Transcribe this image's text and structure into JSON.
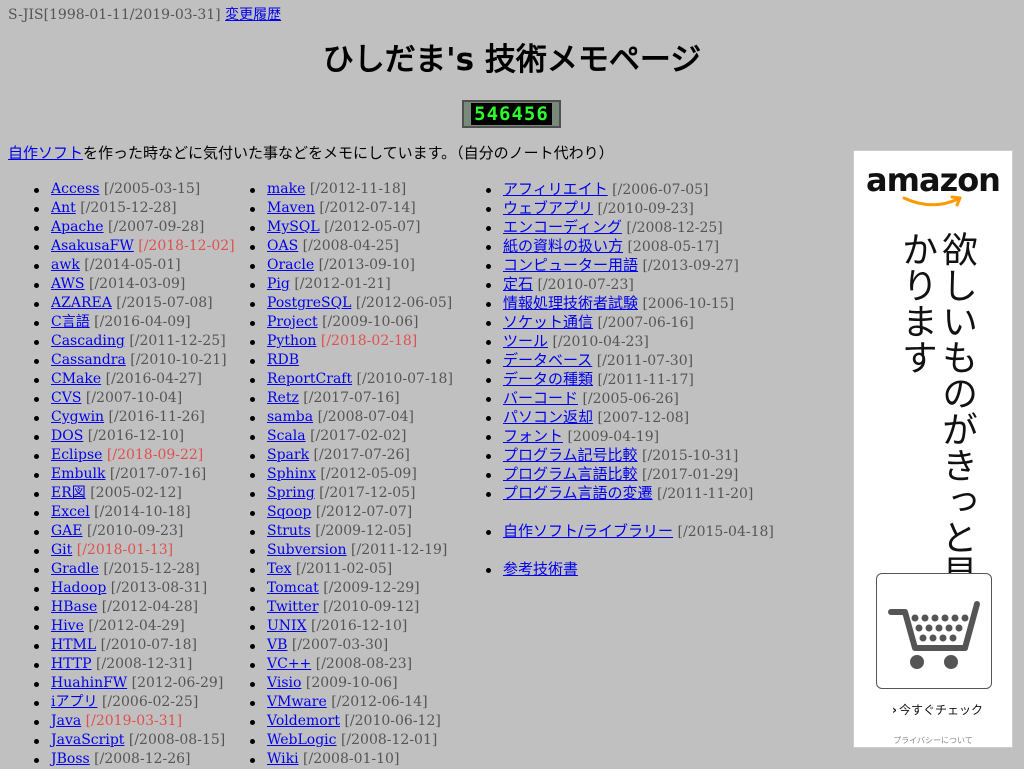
{
  "topline": {
    "prefix": "S-JIS[1998-01-11/2019-03-31]",
    "link": "変更履歴"
  },
  "title": "ひしだま's 技術メモページ",
  "counter": "546456",
  "intro": {
    "link": "自作ソフト",
    "text": "を作った時などに気付いた事などをメモにしています。（自分のノート代わり）"
  },
  "col1": [
    {
      "label": "Access",
      "date": "[/2005-03-15]",
      "red": false
    },
    {
      "label": "Ant",
      "date": "[/2015-12-28]",
      "red": false
    },
    {
      "label": "Apache",
      "date": "[/2007-09-28]",
      "red": false
    },
    {
      "label": "AsakusaFW",
      "date": "[/2018-12-02]",
      "red": true
    },
    {
      "label": "awk",
      "date": "[/2014-05-01]",
      "red": false
    },
    {
      "label": "AWS",
      "date": "[/2014-03-09]",
      "red": false
    },
    {
      "label": "AZAREA",
      "date": "[/2015-07-08]",
      "red": false
    },
    {
      "label": "C言語",
      "date": "[/2016-04-09]",
      "red": false
    },
    {
      "label": "Cascading",
      "date": "[/2011-12-25]",
      "red": false
    },
    {
      "label": "Cassandra",
      "date": "[/2010-10-21]",
      "red": false
    },
    {
      "label": "CMake",
      "date": "[/2016-04-27]",
      "red": false
    },
    {
      "label": "CVS",
      "date": "[/2007-10-04]",
      "red": false
    },
    {
      "label": "Cygwin",
      "date": "[/2016-11-26]",
      "red": false
    },
    {
      "label": "DOS",
      "date": "[/2016-12-10]",
      "red": false
    },
    {
      "label": "Eclipse",
      "date": "[/2018-09-22]",
      "red": true
    },
    {
      "label": "Embulk",
      "date": "[/2017-07-16]",
      "red": false
    },
    {
      "label": "ER図",
      "date": "[2005-02-12]",
      "red": false
    },
    {
      "label": "Excel",
      "date": "[/2014-10-18]",
      "red": false
    },
    {
      "label": "GAE",
      "date": "[/2010-09-23]",
      "red": false
    },
    {
      "label": "Git",
      "date": "[/2018-01-13]",
      "red": true
    },
    {
      "label": "Gradle",
      "date": "[/2015-12-28]",
      "red": false
    },
    {
      "label": "Hadoop",
      "date": "[/2013-08-31]",
      "red": false
    },
    {
      "label": "HBase",
      "date": "[/2012-04-28]",
      "red": false
    },
    {
      "label": "Hive",
      "date": "[/2012-04-29]",
      "red": false
    },
    {
      "label": "HTML",
      "date": "[/2010-07-18]",
      "red": false
    },
    {
      "label": "HTTP",
      "date": "[/2008-12-31]",
      "red": false
    },
    {
      "label": "HuahinFW",
      "date": "[2012-06-29]",
      "red": false
    },
    {
      "label": "iアプリ",
      "date": "[/2006-02-25]",
      "red": false
    },
    {
      "label": "Java",
      "date": "[/2019-03-31]",
      "red": true
    },
    {
      "label": "JavaScript",
      "date": "[/2008-08-15]",
      "red": false
    },
    {
      "label": "JBoss",
      "date": "[/2008-12-26]",
      "red": false
    }
  ],
  "col2": [
    {
      "label": "make",
      "date": "[/2012-11-18]",
      "red": false
    },
    {
      "label": "Maven",
      "date": "[/2012-07-14]",
      "red": false
    },
    {
      "label": "MySQL",
      "date": "[/2012-05-07]",
      "red": false
    },
    {
      "label": "OAS",
      "date": "[/2008-04-25]",
      "red": false
    },
    {
      "label": "Oracle",
      "date": "[/2013-09-10]",
      "red": false
    },
    {
      "label": "Pig",
      "date": "[/2012-01-21]",
      "red": false
    },
    {
      "label": "PostgreSQL",
      "date": "[/2012-06-05]",
      "red": false
    },
    {
      "label": "Project",
      "date": "[/2009-10-06]",
      "red": false
    },
    {
      "label": "Python",
      "date": "[/2018-02-18]",
      "red": true
    },
    {
      "label": "RDB",
      "date": "",
      "red": false
    },
    {
      "label": "ReportCraft",
      "date": "[/2010-07-18]",
      "red": false
    },
    {
      "label": "Retz",
      "date": "[/2017-07-16]",
      "red": false
    },
    {
      "label": "samba",
      "date": "[/2008-07-04]",
      "red": false
    },
    {
      "label": "Scala",
      "date": "[/2017-02-02]",
      "red": false
    },
    {
      "label": "Spark",
      "date": "[/2017-07-26]",
      "red": false
    },
    {
      "label": "Sphinx",
      "date": "[/2012-05-09]",
      "red": false
    },
    {
      "label": "Spring",
      "date": "[/2017-12-05]",
      "red": false
    },
    {
      "label": "Sqoop",
      "date": "[/2012-07-07]",
      "red": false
    },
    {
      "label": "Struts",
      "date": "[/2009-12-05]",
      "red": false
    },
    {
      "label": "Subversion",
      "date": "[/2011-12-19]",
      "red": false
    },
    {
      "label": "Tex",
      "date": "[/2011-02-05]",
      "red": false
    },
    {
      "label": "Tomcat",
      "date": "[/2009-12-29]",
      "red": false
    },
    {
      "label": "Twitter",
      "date": "[/2010-09-12]",
      "red": false
    },
    {
      "label": "UNIX",
      "date": "[/2016-12-10]",
      "red": false
    },
    {
      "label": "VB",
      "date": "[/2007-03-30]",
      "red": false
    },
    {
      "label": "VC++",
      "date": "[/2008-08-23]",
      "red": false
    },
    {
      "label": "Visio",
      "date": "[2009-10-06]",
      "red": false
    },
    {
      "label": "VMware",
      "date": "[/2012-06-14]",
      "red": false
    },
    {
      "label": "Voldemort",
      "date": "[/2010-06-12]",
      "red": false
    },
    {
      "label": "WebLogic",
      "date": "[/2008-12-01]",
      "red": false
    },
    {
      "label": "Wiki",
      "date": "[/2008-01-10]",
      "red": false
    }
  ],
  "col3": [
    {
      "label": "アフィリエイト",
      "date": "[/2006-07-05]",
      "gap_before": false
    },
    {
      "label": "ウェブアプリ",
      "date": "[/2010-09-23]",
      "gap_before": false
    },
    {
      "label": "エンコーディング",
      "date": "[/2008-12-25]",
      "gap_before": false
    },
    {
      "label": "紙の資料の扱い方",
      "date": "[2008-05-17]",
      "gap_before": false
    },
    {
      "label": "コンピューター用語",
      "date": "[/2013-09-27]",
      "gap_before": false
    },
    {
      "label": "定石",
      "date": "[/2010-07-23]",
      "gap_before": false
    },
    {
      "label": "情報処理技術者試験",
      "date": "[2006-10-15]",
      "gap_before": false
    },
    {
      "label": "ソケット通信",
      "date": "[/2007-06-16]",
      "gap_before": false
    },
    {
      "label": "ツール",
      "date": "[/2010-04-23]",
      "gap_before": false
    },
    {
      "label": "データベース",
      "date": "[/2011-07-30]",
      "gap_before": false
    },
    {
      "label": "データの種類",
      "date": "[/2011-11-17]",
      "gap_before": false
    },
    {
      "label": "バーコード",
      "date": "[/2005-06-26]",
      "gap_before": false
    },
    {
      "label": "パソコン返却",
      "date": "[2007-12-08]",
      "gap_before": false
    },
    {
      "label": "フォント",
      "date": "[2009-04-19]",
      "gap_before": false
    },
    {
      "label": "プログラム記号比較",
      "date": "[/2015-10-31]",
      "gap_before": false
    },
    {
      "label": "プログラム言語比較",
      "date": "[/2017-01-29]",
      "gap_before": false
    },
    {
      "label": "プログラム言語の変遷",
      "date": "[/2011-11-20]",
      "gap_before": false
    },
    {
      "label": "自作ソフト/ライブラリー",
      "date": "[/2015-04-18]",
      "gap_before": true
    },
    {
      "label": "参考技術書",
      "date": "",
      "gap_before": true
    }
  ],
  "ad": {
    "logo": "amazon",
    "copy": "欲しいものがきっと見つかります",
    "check": "今すぐチェック",
    "privacy": "プライバシーについて",
    "icons": [
      "amazon-smile-icon",
      "shopping-cart-icon",
      "chevron-right-icon"
    ]
  }
}
